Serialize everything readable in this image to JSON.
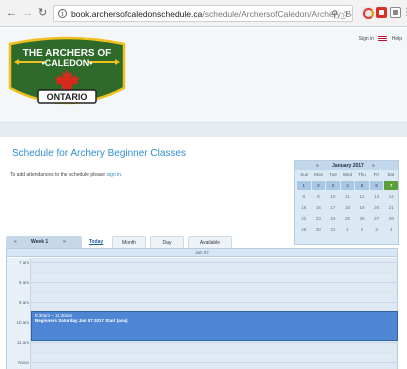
{
  "browser": {
    "url_host": "book.archersofcaledonschedule.ca",
    "url_path": "/schedule/ArchersofCaledon/Archery_Be"
  },
  "header": {
    "logo_line1": "THE ARCHERS OF",
    "logo_line2": "•CALEDON•",
    "logo_line3": "ONTARIO",
    "sign_in": "Sign in",
    "help": "Help"
  },
  "main": {
    "title": "Schedule for Archery Beginner Classes",
    "attend_text": "To add attendances to the schedule please ",
    "attend_link": "sign in",
    "attend_end": "."
  },
  "minical": {
    "prev": "«",
    "next": "»",
    "title": "January 2017",
    "dows": [
      "Sun",
      "Mon",
      "Tue",
      "Wed",
      "Thu",
      "Fri",
      "Sat"
    ],
    "weeks": [
      [
        "1",
        "2",
        "3",
        "4",
        "5",
        "6",
        "7"
      ],
      [
        "8",
        "9",
        "10",
        "11",
        "12",
        "13",
        "14"
      ],
      [
        "15",
        "16",
        "17",
        "18",
        "19",
        "20",
        "21"
      ],
      [
        "22",
        "23",
        "24",
        "25",
        "26",
        "27",
        "28"
      ],
      [
        "29",
        "30",
        "31",
        "1",
        "2",
        "3",
        "4"
      ]
    ]
  },
  "toolbar": {
    "prev": "«",
    "week_label": "Week 1",
    "next": "»",
    "today": "Today",
    "month": "Month",
    "day": "Day",
    "available": "Available"
  },
  "calendar": {
    "header": "Jan 07",
    "times": [
      "7 am",
      "8 am",
      "9 am",
      "10 am",
      "11 am",
      "Noon"
    ],
    "event_time": "9:30am – 11:30am",
    "event_title": "Beginners Saturday Jan 07 2017 Start (ana)"
  },
  "colors": {
    "title_blue": "#2f8fcf",
    "event_blue": "#4f86d4",
    "today_green": "#5aa037",
    "logo_green": "#2e6b2a",
    "logo_red": "#d52b1e",
    "logo_gold": "#f0c020"
  }
}
